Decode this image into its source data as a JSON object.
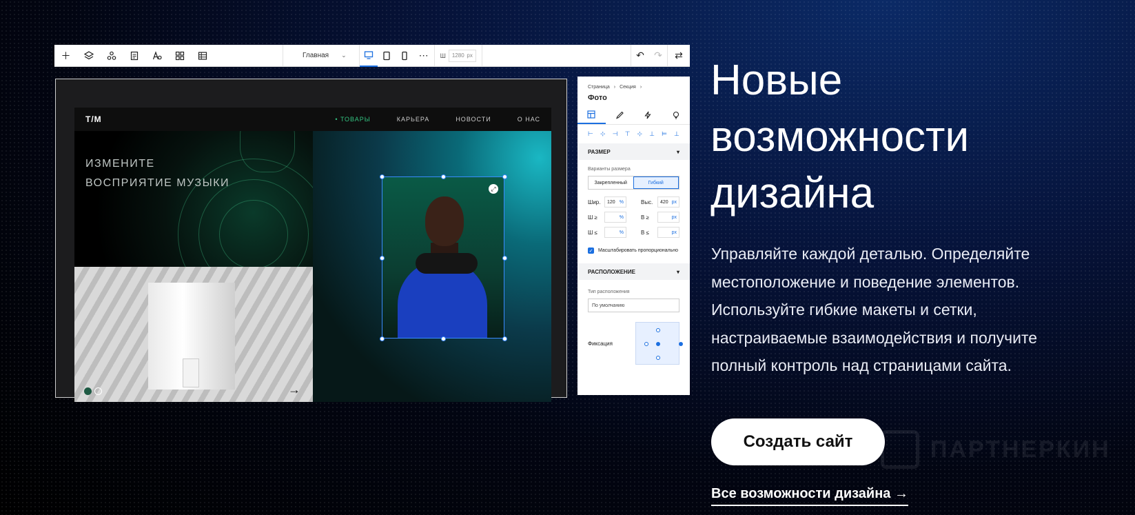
{
  "toolbar": {
    "page_name": "Главная",
    "width_label": "Ш",
    "width_value": "1280",
    "width_unit": "px",
    "icons": [
      "plus-icon",
      "layers-icon",
      "components-icon",
      "pages-icon",
      "text-styles-icon",
      "apps-icon",
      "table-icon",
      "desktop-icon",
      "tablet-icon",
      "mobile-icon",
      "more-icon",
      "undo-icon",
      "redo-icon",
      "settings-icon"
    ]
  },
  "site": {
    "logo": "T/M",
    "nav": [
      "• ТОВАРЫ",
      "КАРЬЕРА",
      "НОВОСТИ",
      "О НАС"
    ],
    "hero_line1": "ИЗМЕНИТЕ",
    "hero_line2": "ВОСПРИЯТИЕ МУЗЫКИ",
    "next_arrow": "→"
  },
  "inspector": {
    "crumb1": "Страница",
    "crumb2": "Секция",
    "title": "Фото",
    "size_section": "РАЗМЕР",
    "size_variants": "Варианты размера",
    "fixed": "Закрепленный",
    "flexible": "Гибкий",
    "w_label": "Шир.",
    "w_value": "120",
    "w_unit": "%",
    "h_label": "Выс.",
    "h_value": "420",
    "h_unit": "px",
    "wmin_label": "Ш ≥",
    "hmin_label": "В ≥",
    "wmax_label": "Ш ≤",
    "hmax_label": "В ≤",
    "pct": "%",
    "px": "px",
    "scale_label": "Масштабировать пропорционально",
    "position_section": "РАСПОЛОЖЕНИЕ",
    "position_type_label": "Тип расположения",
    "position_type_value": "По умолчанию",
    "pin_label": "Фиксация"
  },
  "marketing": {
    "headline_1": "Новые",
    "headline_2": "возможности",
    "headline_3": "дизайна",
    "desc_1": "Управляйте каждой деталью. Определяйте",
    "desc_2": "местоположение и поведение элементов.",
    "desc_3": "Используйте гибкие макеты и сетки,",
    "desc_4": "настраиваемые взаимодействия и получите",
    "desc_5": "полный контроль над страницами сайта.",
    "cta": "Создать сайт",
    "link": "Все возможности дизайна →",
    "watermark": "ПАРТНЕРКИН"
  },
  "colors": {
    "accent": "#1b6fe0",
    "nav_active": "#33c481"
  }
}
